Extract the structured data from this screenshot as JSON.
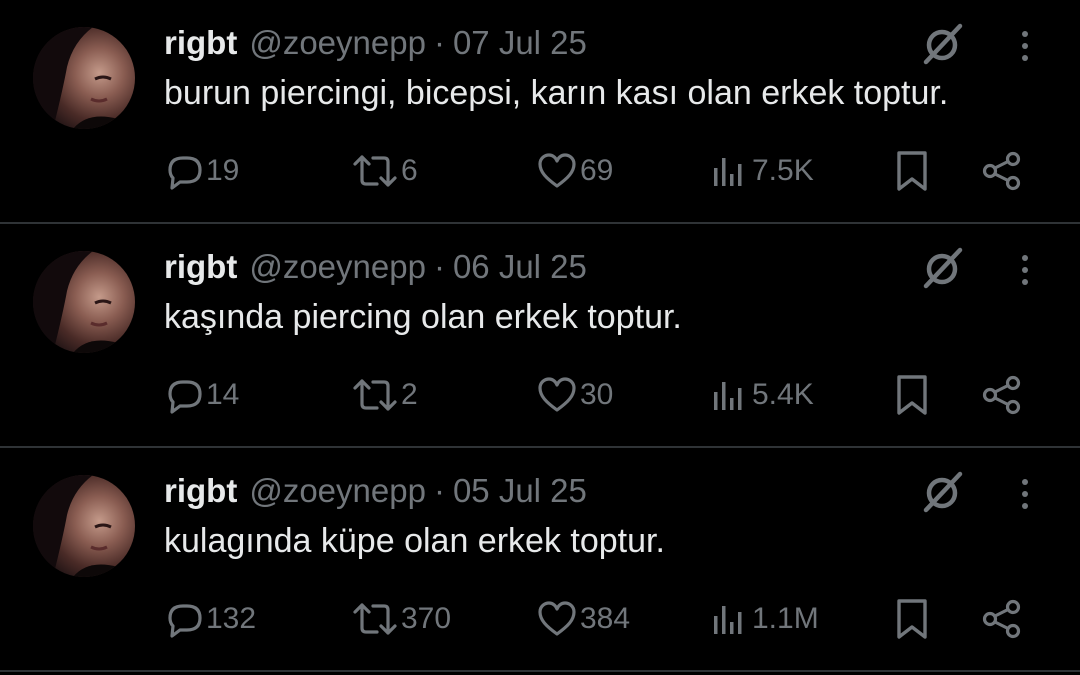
{
  "colors": {
    "background": "#000000",
    "text_primary": "#e7e9ea",
    "text_secondary": "#71767b",
    "divider": "#2f3336"
  },
  "icons": {
    "reply": "reply-icon",
    "retweet": "retweet-icon",
    "like": "heart-icon",
    "views": "views-icon",
    "bookmark": "bookmark-icon",
    "share": "share-icon",
    "grok": "grok-icon",
    "more": "more-icon"
  },
  "tweets": [
    {
      "name": "rigbt",
      "handle": "@zoeynepp",
      "separator": "·",
      "date": "07 Jul 25",
      "text": "burun piercingi, bicepsi, karın kası olan erkek toptur.",
      "replies": "19",
      "retweets": "6",
      "likes": "69",
      "views": "7.5K"
    },
    {
      "name": "rigbt",
      "handle": "@zoeynepp",
      "separator": "·",
      "date": "06 Jul 25",
      "text": "kaşında piercing olan erkek toptur.",
      "replies": "14",
      "retweets": "2",
      "likes": "30",
      "views": "5.4K"
    },
    {
      "name": "rigbt",
      "handle": "@zoeynepp",
      "separator": "·",
      "date": "05 Jul 25",
      "text": "kulagında küpe olan erkek toptur.",
      "replies": "132",
      "retweets": "370",
      "likes": "384",
      "views": "1.1M"
    }
  ]
}
